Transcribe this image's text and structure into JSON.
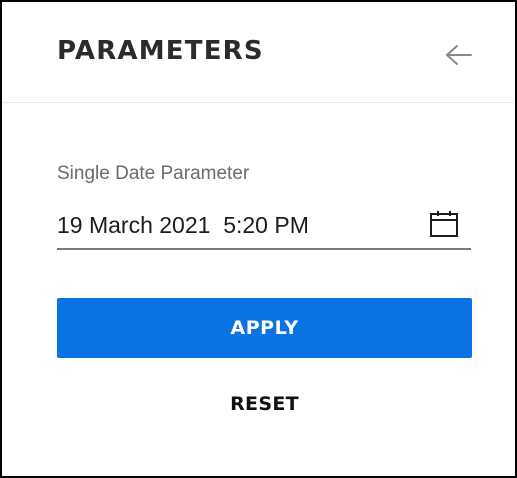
{
  "panel": {
    "title": "PARAMETERS",
    "back_icon": "arrow-left-icon"
  },
  "parameter": {
    "label": "Single Date Parameter",
    "value": "19 March 2021  5:20 PM",
    "calendar_icon": "calendar-icon"
  },
  "actions": {
    "apply_label": "APPLY",
    "reset_label": "RESET"
  },
  "colors": {
    "accent": "#0b73e3",
    "title_text": "#2b2b2b",
    "label_text": "#6b6b6b"
  }
}
